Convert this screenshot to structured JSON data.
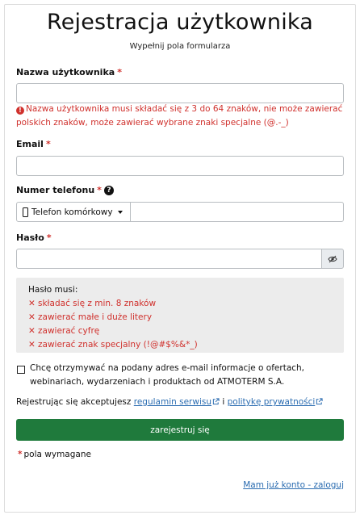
{
  "header": {
    "title": "Rejestracja użytkownika",
    "subtitle": "Wypełnij pola formularza"
  },
  "required_marker": "*",
  "username": {
    "label": "Nazwa użytkownika",
    "value": "",
    "error": "Nazwa użytkownika musi składać się z 3 do 64 znaków, nie może zawierać polskich znaków, może zawierać wybrane znaki specjalne (@.-_)"
  },
  "email": {
    "label": "Email",
    "value": ""
  },
  "phone": {
    "label": "Numer telefonu",
    "type_selected": "Telefon komórkowy",
    "value": ""
  },
  "password": {
    "label": "Hasło",
    "value": ""
  },
  "password_rules": {
    "heading": "Hasło musi:",
    "items": [
      "składać się z min. 8 znaków",
      "zawierać małe i duże litery",
      "zawierać cyfrę",
      "zawierać znak specjalny (!@#$%&*_)"
    ]
  },
  "consent": {
    "checked": false,
    "text": "Chcę otrzymywać na podany adres e-mail informacje o ofertach, webinariach, wydarzeniach i produktach od ATMOTERM S.A."
  },
  "terms": {
    "prefix": "Rejestrując się akceptujesz",
    "regulations_link": "regulamin serwisu",
    "joiner": "i",
    "privacy_link": "politykę prywatności"
  },
  "submit_label": "zarejestruj się",
  "required_note": "pola wymagane",
  "login_link": "Mam już konto - zaloguj",
  "colors": {
    "error": "#d0312d",
    "submit_bg": "#1f7a3c",
    "link": "#2c6db1"
  }
}
